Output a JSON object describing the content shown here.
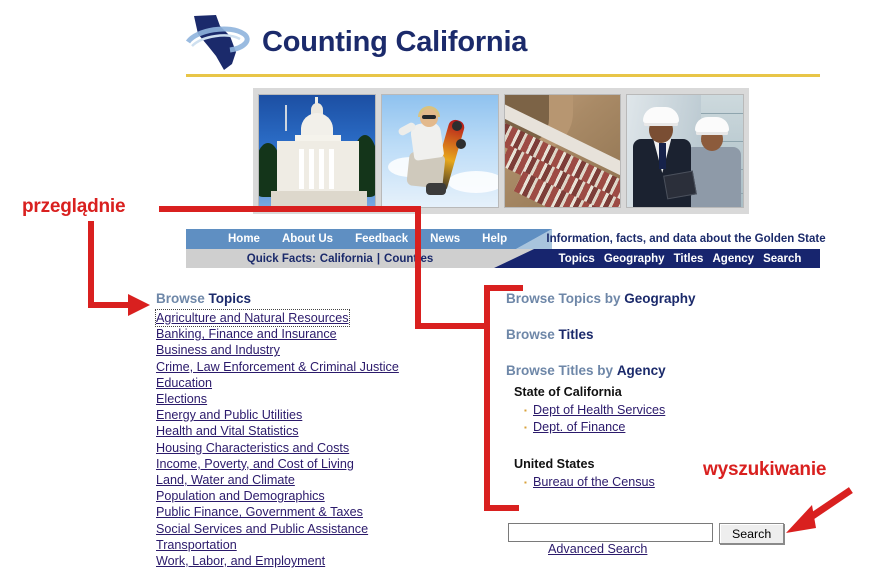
{
  "header": {
    "site_title": "Counting California",
    "logo_icon": "california-state-outline-with-swoosh-logo"
  },
  "banner": {
    "photos": [
      {
        "name": "california-state-capitol-photo",
        "alt": "California State Capitol dome"
      },
      {
        "name": "skateboarder-photo",
        "alt": "Skateboarder mid-air"
      },
      {
        "name": "aerial-housing-development-photo",
        "alt": "Aerial view of hillside housing tracts"
      },
      {
        "name": "professionals-hardhats-photo",
        "alt": "Man and woman wearing white hard hats"
      }
    ]
  },
  "nav": {
    "top_items": [
      {
        "label": "Home",
        "name": "nav-home"
      },
      {
        "label": "About Us",
        "name": "nav-about-us"
      },
      {
        "label": "Feedback",
        "name": "nav-feedback"
      },
      {
        "label": "News",
        "name": "nav-news"
      },
      {
        "label": "Help",
        "name": "nav-help"
      }
    ],
    "tagline": "Information, facts, and data about the Golden State",
    "quickfacts_label": "Quick Facts:",
    "quickfacts_california": "California",
    "quickfacts_separator": "|",
    "quickfacts_counties": "Counties",
    "bottom_items": [
      {
        "label": "Topics",
        "name": "nav-topics"
      },
      {
        "label": "Geography",
        "name": "nav-geography"
      },
      {
        "label": "Titles",
        "name": "nav-titles"
      },
      {
        "label": "Agency",
        "name": "nav-agency"
      },
      {
        "label": "Search",
        "name": "nav-search"
      }
    ]
  },
  "left_column": {
    "heading_light": "Browse",
    "heading_bold": "Topics",
    "topics": [
      "Agriculture and Natural Resources",
      "Banking, Finance and Insurance",
      "Business and Industry",
      "Crime, Law Enforcement & Criminal Justice",
      "Education",
      "Elections",
      "Energy and Public Utilities",
      "Health and Vital Statistics",
      "Housing Characteristics and Costs",
      "Income, Poverty, and Cost of Living",
      "Land, Water and Climate",
      "Population and Demographics",
      "Public Finance, Government & Taxes",
      "Social Services and Public Assistance",
      "Transportation",
      "Work, Labor, and Employment"
    ]
  },
  "right_column": {
    "block1_light": "Browse Topics by",
    "block1_bold": "Geography",
    "block2_light": "Browse",
    "block2_bold": "Titles",
    "block3_light": "Browse Titles by",
    "block3_bold": "Agency",
    "agency_groups": [
      {
        "group": "State of California",
        "items": [
          "Dept of Health Services",
          "Dept. of Finance"
        ]
      },
      {
        "group": "United States",
        "items": [
          "Bureau of the Census"
        ]
      }
    ]
  },
  "search": {
    "value": "",
    "placeholder": "",
    "button_label": "Search",
    "advanced_label": "Advanced Search"
  },
  "annotations": {
    "left_label": "przeglądnie",
    "right_label": "wyszukiwanie",
    "color": "#d9201f"
  },
  "colors": {
    "navy": "#17256e",
    "title_navy": "#1b2a6b",
    "nav_blue": "#5f8fc2",
    "nav_gray": "#cfcfcf",
    "gold_rule": "#e8c547",
    "link": "#2b1a6b",
    "bullet_gold": "#d8a13a",
    "annotation_red": "#d9201f"
  }
}
